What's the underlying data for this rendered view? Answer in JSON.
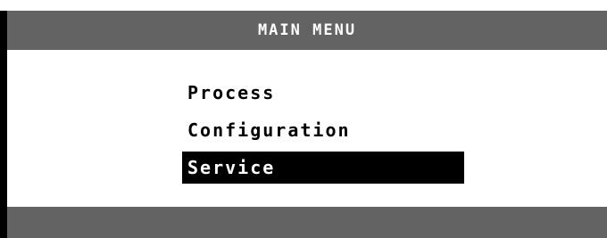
{
  "header": {
    "title": "MAIN MENU"
  },
  "menu": {
    "items": [
      {
        "label": "Process",
        "selected": false
      },
      {
        "label": "Configuration",
        "selected": false
      },
      {
        "label": "Service",
        "selected": true
      }
    ]
  },
  "colors": {
    "bar_gray": "#636363",
    "selection_bg": "#000000",
    "selection_fg": "#ffffff",
    "background": "#ffffff"
  }
}
